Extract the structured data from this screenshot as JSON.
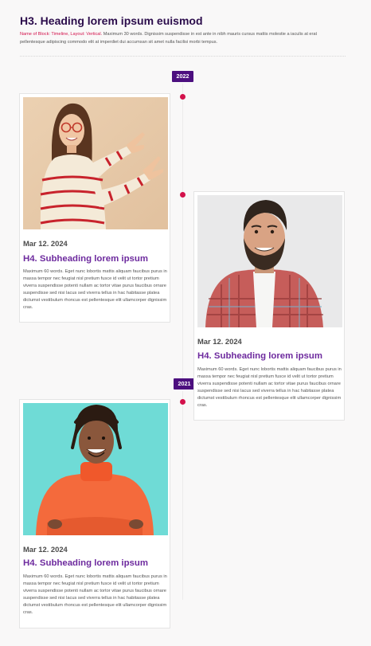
{
  "header": {
    "title": "H3. Heading lorem ipsum euismod",
    "meta_label": "Name of Block: Timeline, Layout: Vertical.",
    "description": " Maximum 30 words. Dignissim suspendisse in est ante in nibh mauris cursus mattis molestie a iaculis at erat pellentesque adipiscing commodo elit at imperdiet dui accumsan sit amet nulla facilisi morbi tempus."
  },
  "years": [
    "2022",
    "2021"
  ],
  "colors": {
    "accent": "#d3114b",
    "badge_bg": "#4c0f7f",
    "title": "#2b0c4b",
    "subheading": "#6d2a9e"
  },
  "entries": [
    {
      "photo": "woman-pointing-photo",
      "date": "Mar 12. 2024",
      "subheading": "H4. Subheading lorem ipsum",
      "body": "Maximum 60 words. Eget nunc lobortis mattis aliquam faucibus purus in massa tempor nec feugiat nisl pretium fusce id velit ut tortor pretium viverra suspendisse potenti nullam ac tortor vitae purus faucibus ornare suspendisse sed nisi lacus sed viverra tellus in hac habitasse platea dictumst vestibulum rhoncus est pellentesque elit ullamcorper dignissim cras."
    },
    {
      "photo": "bearded-man-photo",
      "date": "Mar 12. 2024",
      "subheading": "H4. Subheading lorem ipsum",
      "body": "Maximum 60 words. Eget nunc lobortis mattis aliquam faucibus purus in massa tempor nec feugiat nisl pretium fusce id velit ut tortor pretium viverra suspendisse potenti nullam ac tortor vitae purus faucibus ornare suspendisse sed nisi lacus sed viverra tellus in hac habitasse platea dictumst vestibulum rhoncus est pellentesque elit ullamcorper dignissim cras."
    },
    {
      "photo": "man-orange-sweater-photo",
      "date": "Mar 12. 2024",
      "subheading": "H4. Subheading lorem ipsum",
      "body": "Maximum 60 words. Eget nunc lobortis mattis aliquam faucibus purus in massa tempor nec feugiat nisl pretium fusce id velit ut tortor pretium viverra suspendisse potenti nullam ac tortor vitae purus faucibus ornare suspendisse sed nisi lacus sed viverra tellus in hac habitasse platea dictumst vestibulum rhoncus est pellentesque elit ullamcorper dignissim cras."
    }
  ]
}
